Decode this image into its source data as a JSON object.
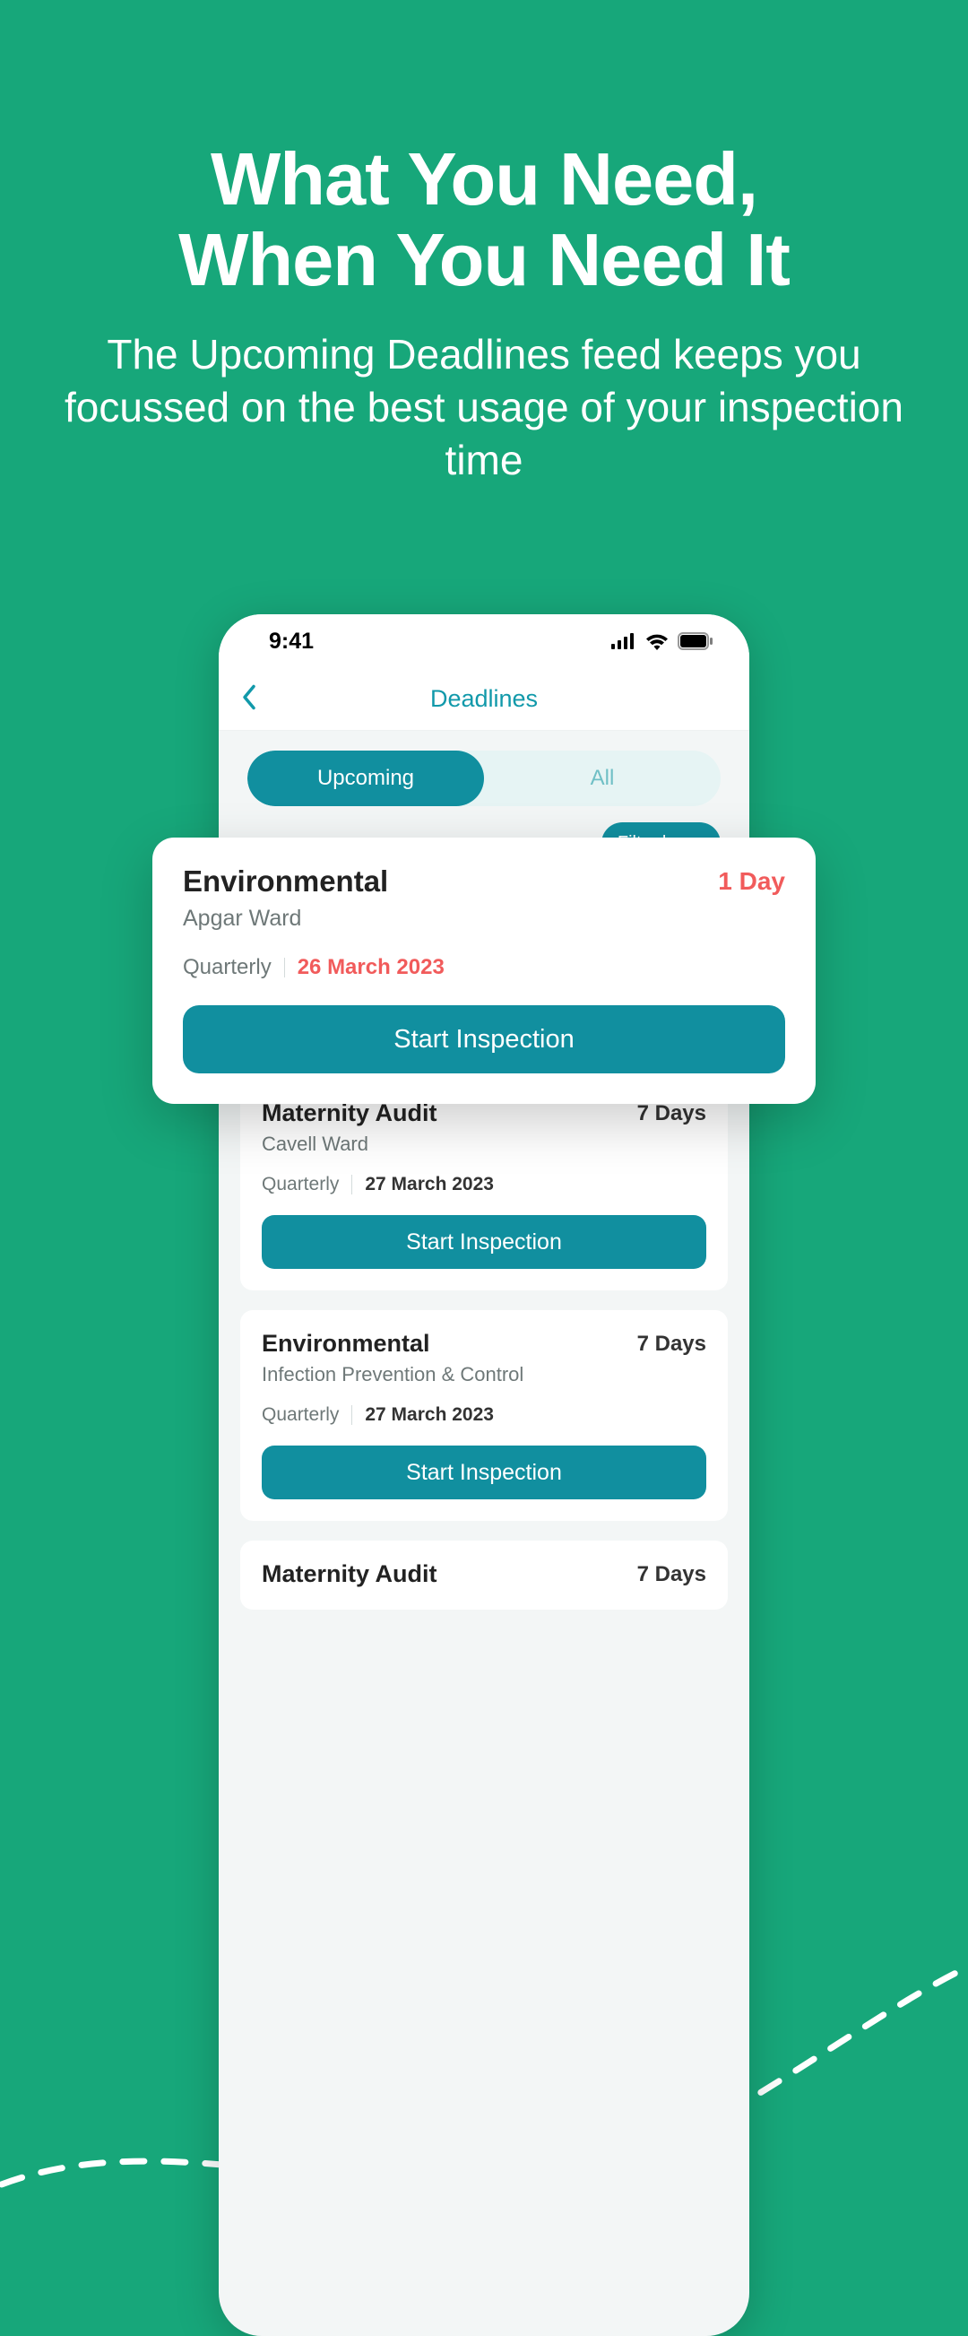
{
  "hero": {
    "title_line1": "What You Need,",
    "title_line2": "When You Need It",
    "subtitle": "The Upcoming Deadlines feed keeps you focussed on the best usage of your inspection time"
  },
  "status": {
    "time": "9:41"
  },
  "nav": {
    "title": "Deadlines"
  },
  "segmented": {
    "upcoming": "Upcoming",
    "all": "All"
  },
  "filter": {
    "label": "Filter by"
  },
  "cards": [
    {
      "title": "Environmental",
      "sub": "Apgar Ward",
      "freq": "Quarterly",
      "date": "26 March 2023",
      "days": "1 Day",
      "cta": "Start Inspection"
    },
    {
      "title": "Maternity Audit",
      "sub": "Cavell Ward",
      "freq": "Quarterly",
      "date": "27 March 2023",
      "days": "7 Days",
      "cta": "Start Inspection"
    },
    {
      "title": "Environmental",
      "sub": "Infection Prevention & Control",
      "freq": "Quarterly",
      "date": "27 March 2023",
      "days": "7 Days",
      "cta": "Start Inspection"
    },
    {
      "title": "Maternity Audit",
      "sub": "",
      "freq": "",
      "date": "",
      "days": "7 Days",
      "cta": ""
    }
  ]
}
